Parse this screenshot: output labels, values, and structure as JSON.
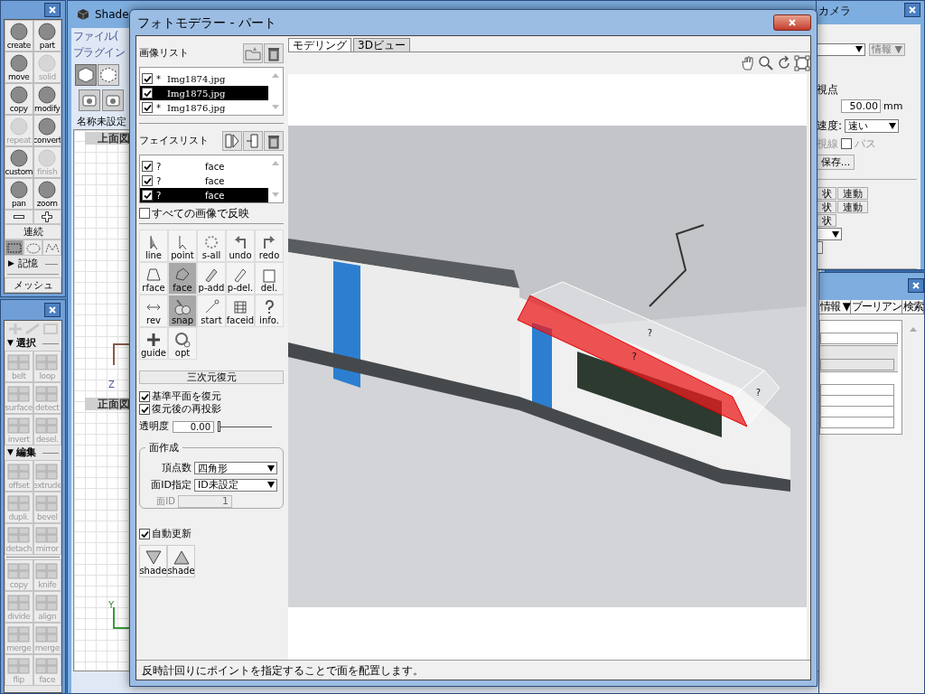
{
  "palette_top": {
    "tools": [
      {
        "label": "create",
        "disabled": false
      },
      {
        "label": "part",
        "disabled": false
      },
      {
        "label": "move",
        "disabled": false
      },
      {
        "label": "solid",
        "disabled": true
      },
      {
        "label": "copy",
        "disabled": false
      },
      {
        "label": "modify",
        "disabled": false
      },
      {
        "label": "repeat",
        "disabled": true
      },
      {
        "label": "convert",
        "disabled": false
      },
      {
        "label": "custom",
        "disabled": false
      },
      {
        "label": "finish",
        "disabled": true
      },
      {
        "label": "pan",
        "disabled": false
      },
      {
        "label": "zoom",
        "disabled": false
      }
    ],
    "continuous": "連続",
    "select_modes": [
      {
        "selected": true
      },
      {
        "selected": false
      },
      {
        "selected": false
      }
    ],
    "memory": {
      "arrow": "▶",
      "label": "記憶"
    },
    "mesh": "メッシュ"
  },
  "palette_bottom": {
    "sections": [
      {
        "arrow": "▼",
        "title": "選択",
        "tools": [
          {
            "label": "belt",
            "disabled": true
          },
          {
            "label": "loop",
            "disabled": true
          },
          {
            "label": "surface",
            "disabled": true
          },
          {
            "label": "detect",
            "disabled": true
          },
          {
            "label": "invert",
            "disabled": true
          },
          {
            "label": "desel.",
            "disabled": true
          }
        ]
      },
      {
        "arrow": "▼",
        "title": "編集",
        "tools": [
          {
            "label": "offset",
            "disabled": true
          },
          {
            "label": "extrude",
            "disabled": true
          },
          {
            "label": "dupli.",
            "disabled": true
          },
          {
            "label": "bevel",
            "disabled": true
          },
          {
            "label": "detach",
            "disabled": true
          },
          {
            "label": "mirror",
            "disabled": true
          }
        ]
      },
      {
        "tools": [
          {
            "label": "copy",
            "disabled": true
          },
          {
            "label": "knife",
            "disabled": true
          },
          {
            "label": "divide",
            "disabled": true
          },
          {
            "label": "align",
            "disabled": true
          },
          {
            "label": "merge",
            "disabled": true
          },
          {
            "label": "merge",
            "disabled": true
          },
          {
            "label": "flip",
            "disabled": true
          },
          {
            "label": "face",
            "disabled": true
          }
        ]
      }
    ]
  },
  "shade_window": {
    "title": "Shade",
    "menu": [
      "ファイル(",
      "プラグイン"
    ],
    "document": "名称未設定",
    "views": [
      "上面図",
      "正面図"
    ],
    "axes": [
      "Z",
      "Y"
    ]
  },
  "camera_window": {
    "title": "カメラ",
    "info_button": "情報 ▼",
    "viewpoint": "視点",
    "distance": "50.00",
    "unit": "mm",
    "speed_label": "速度:",
    "speed": "速い",
    "sight": "視線",
    "path": {
      "label": "パス",
      "checked": false
    },
    "save_button": "保存...",
    "link_rows": [
      {
        "shape": "状",
        "link": "連動"
      },
      {
        "shape": "状",
        "link": "連動"
      },
      {
        "shape": "状"
      }
    ]
  },
  "browser_window": {
    "tabs": [
      "情報 ▼",
      "ブーリアン",
      "検索"
    ]
  },
  "dialog": {
    "title": "フォトモデラー - パート",
    "image_list": {
      "label": "画像リスト",
      "items": [
        {
          "mark": "*",
          "name": "Img1874.jpg",
          "checked": true,
          "selected": false
        },
        {
          "name": "Img1875.jpg",
          "checked": true,
          "selected": true
        },
        {
          "mark": "*",
          "name": "Img1876.jpg",
          "checked": true,
          "selected": false
        }
      ]
    },
    "face_list": {
      "label": "フェイスリスト",
      "items": [
        {
          "id": "?",
          "name": "face",
          "checked": true,
          "selected": false
        },
        {
          "id": "?",
          "name": "face",
          "checked": true,
          "selected": false
        },
        {
          "id": "?",
          "name": "face",
          "checked": true,
          "selected": true
        }
      ]
    },
    "apply_all": {
      "label": "すべての画像で反映",
      "checked": false
    },
    "tools": [
      {
        "label": "line",
        "selected": false
      },
      {
        "label": "point",
        "selected": false
      },
      {
        "label": "s-all",
        "selected": false
      },
      {
        "label": "undo",
        "selected": false
      },
      {
        "label": "redo",
        "selected": false
      },
      {
        "label": "rface",
        "selected": false
      },
      {
        "label": "face",
        "selected": true
      },
      {
        "label": "p-add",
        "selected": false
      },
      {
        "label": "p-del.",
        "selected": false
      },
      {
        "label": "del.",
        "selected": false
      },
      {
        "label": "rev",
        "selected": false
      },
      {
        "label": "snap",
        "selected": true
      },
      {
        "label": "start",
        "selected": false
      },
      {
        "label": "faceid",
        "selected": false
      },
      {
        "label": "info.",
        "selected": false
      },
      {
        "label": "guide",
        "selected": false
      },
      {
        "label": "opt",
        "selected": false
      }
    ],
    "reconstruct_button": "三次元復元",
    "options": [
      {
        "label": "基準平面を復元",
        "checked": true
      },
      {
        "label": "復元後の再投影",
        "checked": true
      }
    ],
    "opacity": {
      "label": "透明度",
      "value": "0.00",
      "level": 0
    },
    "face_creation": {
      "title": "面作成",
      "vertex_count": {
        "label": "頂点数",
        "value": "四角形"
      },
      "face_id_mode": {
        "label": "面ID指定",
        "value": "ID未設定"
      },
      "face_id": {
        "label": "面ID",
        "value": "1",
        "disabled": true
      }
    },
    "auto_update": {
      "label": "自動更新",
      "checked": true
    },
    "shade_buttons": [
      {
        "label": "shade",
        "kind": "down"
      },
      {
        "label": "shade",
        "kind": "up"
      }
    ],
    "tabs": [
      {
        "label": "モデリング",
        "selected": true
      },
      {
        "label": "3Dビュー",
        "selected": false
      }
    ],
    "status": "反時計回りにポイントを指定することで面を配置します。"
  }
}
